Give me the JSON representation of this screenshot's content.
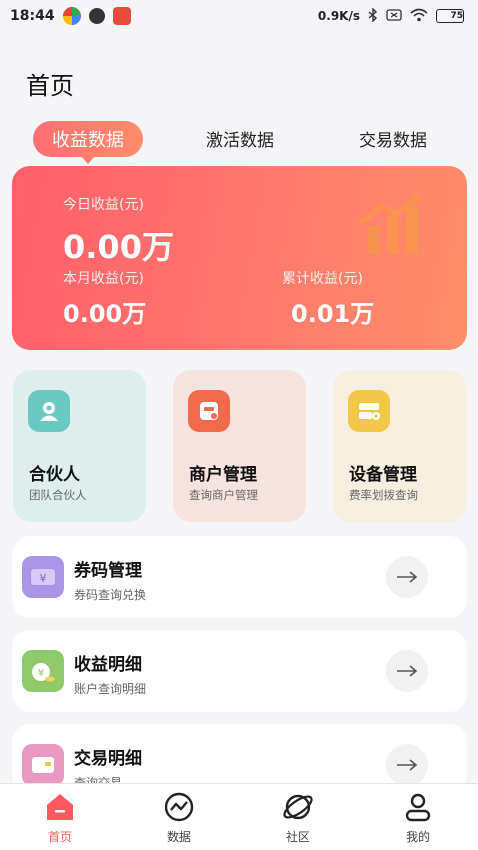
{
  "status_bar": {
    "time": "18:44",
    "net_speed": "0.9K/s",
    "battery": "75"
  },
  "page": {
    "title": "首页"
  },
  "tabs": [
    {
      "label": "收益数据",
      "active": true
    },
    {
      "label": "激活数据",
      "active": false
    },
    {
      "label": "交易数据",
      "active": false
    }
  ],
  "revenue": {
    "today_label": "今日收益(元)",
    "today_value": "0.00万",
    "month_label": "本月收益(元)",
    "month_value": "0.00万",
    "total_label": "累计收益(元)",
    "total_value": "0.01万"
  },
  "features": [
    {
      "title": "合伙人",
      "subtitle": "团队合伙人",
      "icon": "partner-icon",
      "bg": "#deeeed",
      "icon_bg": "#6cc9c1"
    },
    {
      "title": "商户管理",
      "subtitle": "查询商户管理",
      "icon": "merchant-icon",
      "bg": "#f5e3df",
      "icon_bg": "#f06b4b"
    },
    {
      "title": "设备管理",
      "subtitle": "费率划拨查询",
      "icon": "device-icon",
      "bg": "#f6efdf",
      "icon_bg": "#f3c84a"
    }
  ],
  "list": [
    {
      "title": "券码管理",
      "subtitle": "券码查询兑换",
      "icon": "coupon-icon",
      "icon_bg": "#a994e6"
    },
    {
      "title": "收益明细",
      "subtitle": "账户查询明细",
      "icon": "money-bag-icon",
      "icon_bg": "#8fca6a"
    },
    {
      "title": "交易明细",
      "subtitle": "查询交易",
      "icon": "wallet-icon",
      "icon_bg": "#e99ac0"
    }
  ],
  "nav": [
    {
      "label": "首页",
      "icon": "home-icon",
      "active": true
    },
    {
      "label": "数据",
      "icon": "chart-icon",
      "active": false
    },
    {
      "label": "社区",
      "icon": "planet-icon",
      "active": false
    },
    {
      "label": "我的",
      "icon": "user-icon",
      "active": false
    }
  ],
  "colors": {
    "accent": "#ff5a5f"
  }
}
